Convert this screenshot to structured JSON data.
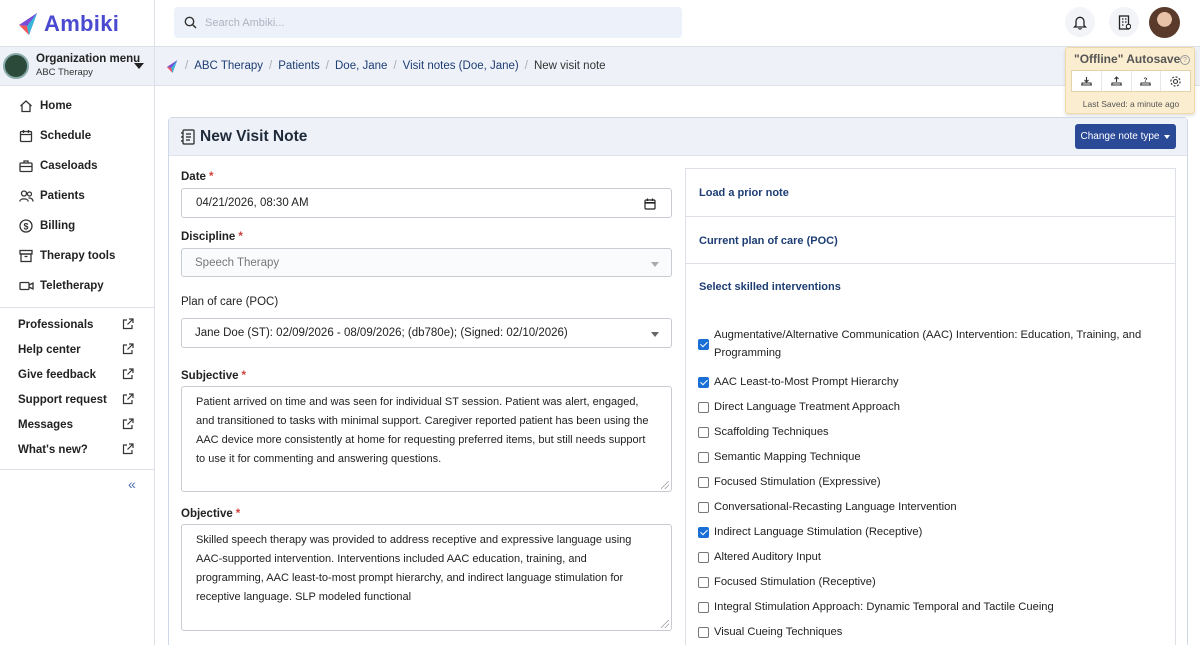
{
  "app": {
    "name": "Ambiki"
  },
  "org": {
    "menu_label": "Organization menu",
    "name": "ABC Therapy"
  },
  "search": {
    "placeholder": "Search Ambiki..."
  },
  "sidebar": {
    "nav": [
      {
        "label": "Home",
        "icon": "home-icon"
      },
      {
        "label": "Schedule",
        "icon": "calendar-icon"
      },
      {
        "label": "Caseloads",
        "icon": "briefcase-icon"
      },
      {
        "label": "Patients",
        "icon": "people-icon"
      },
      {
        "label": "Billing",
        "icon": "dollar-icon"
      },
      {
        "label": "Therapy tools",
        "icon": "archive-icon"
      },
      {
        "label": "Teletherapy",
        "icon": "video-icon"
      }
    ],
    "links": [
      {
        "label": "Professionals"
      },
      {
        "label": "Help center"
      },
      {
        "label": "Give feedback"
      },
      {
        "label": "Support request"
      },
      {
        "label": "Messages"
      },
      {
        "label": "What's new?"
      }
    ]
  },
  "breadcrumb": [
    "ABC Therapy",
    "Patients",
    "Doe, Jane",
    "Visit notes (Doe, Jane)",
    "New visit note"
  ],
  "autosave": {
    "title": "\"Offline\" Autosave",
    "help": "?",
    "last_saved": "Last Saved: a minute ago"
  },
  "panel": {
    "title": "New Visit Note",
    "change_btn": "Change note type"
  },
  "form": {
    "date": {
      "label": "Date",
      "value": "04/21/2026, 08:30  AM"
    },
    "discipline": {
      "label": "Discipline",
      "value": "Speech Therapy"
    },
    "poc": {
      "label": "Plan of care (POC)",
      "value": "Jane Doe (ST): 02/09/2026 - 08/09/2026; (db780e); (Signed: 02/10/2026)"
    },
    "subjective": {
      "label": "Subjective",
      "text": "Patient arrived on time and was seen for individual ST session. Patient was alert, engaged, and transitioned to tasks with minimal support. Caregiver reported patient has been using the AAC device more consistently at home for requesting preferred items, but still needs support to use it for commenting and answering questions."
    },
    "objective": {
      "label": "Objective",
      "text": "Skilled speech therapy was provided to address receptive and expressive language using AAC-supported intervention. Interventions included AAC education, training, and programming, AAC least-to-most prompt hierarchy, and indirect language stimulation for receptive language. SLP modeled functional"
    },
    "required_mark": "*"
  },
  "right": {
    "load_prior": "Load a prior note",
    "current_poc": "Current plan of care (POC)",
    "skilled_title": "Select skilled interventions",
    "interventions": [
      {
        "label": "Augmentative/Alternative Communication (AAC) Intervention: Education, Training, and Programming",
        "checked": true
      },
      {
        "label": "AAC Least-to-Most Prompt Hierarchy",
        "checked": true
      },
      {
        "label": "Direct Language Treatment Approach",
        "checked": false
      },
      {
        "label": "Scaffolding Techniques",
        "checked": false
      },
      {
        "label": "Semantic Mapping Technique",
        "checked": false
      },
      {
        "label": "Focused Stimulation (Expressive)",
        "checked": false
      },
      {
        "label": "Conversational-Recasting Language Intervention",
        "checked": false
      },
      {
        "label": "Indirect Language Stimulation (Receptive)",
        "checked": true
      },
      {
        "label": "Altered Auditory Input",
        "checked": false
      },
      {
        "label": "Focused Stimulation (Receptive)",
        "checked": false
      },
      {
        "label": "Integral Stimulation Approach: Dynamic Temporal and Tactile Cueing",
        "checked": false
      },
      {
        "label": "Visual Cueing Techniques",
        "checked": false
      }
    ]
  },
  "colors": {
    "accent": "#2a4a98",
    "link": "#1d3d73",
    "autosave_bg": "#fbeed0",
    "check": "#1a6fd6"
  }
}
